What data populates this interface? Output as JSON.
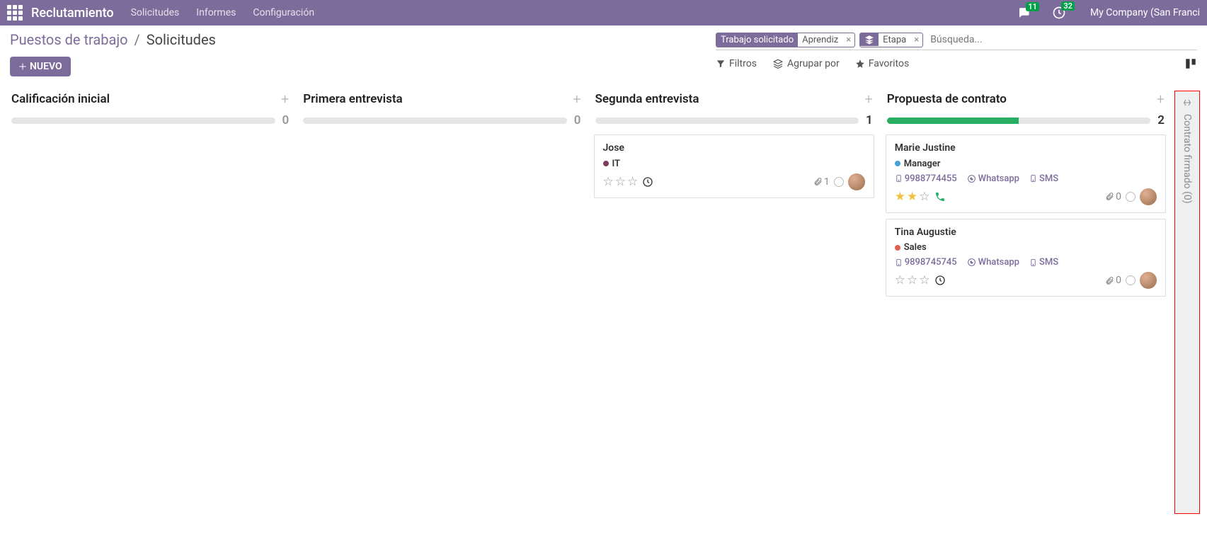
{
  "nav": {
    "app_name": "Reclutamiento",
    "links": [
      "Solicitudes",
      "Informes",
      "Configuración"
    ],
    "messages_count": "11",
    "activities_count": "32",
    "company": "My Company (San Franci"
  },
  "breadcrumb": {
    "root": "Puestos de trabajo",
    "sep": "/",
    "current": "Solicitudes"
  },
  "buttons": {
    "new": "NUEVO"
  },
  "search": {
    "facet1_label": "Trabajo solicitado",
    "facet1_value": "Aprendiz",
    "facet2_value": "Etapa",
    "placeholder": "Búsqueda..."
  },
  "filters": {
    "filtros": "Filtros",
    "agrupar": "Agrupar por",
    "favoritos": "Favoritos"
  },
  "columns": [
    {
      "title": "Calificación inicial",
      "count": "0",
      "progress": 0,
      "cards": []
    },
    {
      "title": "Primera entrevista",
      "count": "0",
      "progress": 0,
      "cards": []
    },
    {
      "title": "Segunda entrevista",
      "count": "1",
      "progress": 0,
      "cards": [
        {
          "name": "Jose",
          "tag": "IT",
          "tag_color": "#7a3b5c",
          "phone": "",
          "whatsapp": "",
          "sms": "",
          "stars": 0,
          "trailing_icon": "clock",
          "attach": "1"
        }
      ]
    },
    {
      "title": "Propuesta de contrato",
      "count": "2",
      "progress": 50,
      "cards": [
        {
          "name": "Marie Justine",
          "tag": "Manager",
          "tag_color": "#45a2d6",
          "phone": "9988774455",
          "whatsapp": "Whatsapp",
          "sms": "SMS",
          "stars": 2,
          "trailing_icon": "phone",
          "attach": "0"
        },
        {
          "name": "Tina Augustie",
          "tag": "Sales",
          "tag_color": "#e06050",
          "phone": "9898745745",
          "whatsapp": "Whatsapp",
          "sms": "SMS",
          "stars": 0,
          "trailing_icon": "clock",
          "attach": "0"
        }
      ]
    }
  ],
  "folded": {
    "title": "Contrato firmado (0)"
  }
}
